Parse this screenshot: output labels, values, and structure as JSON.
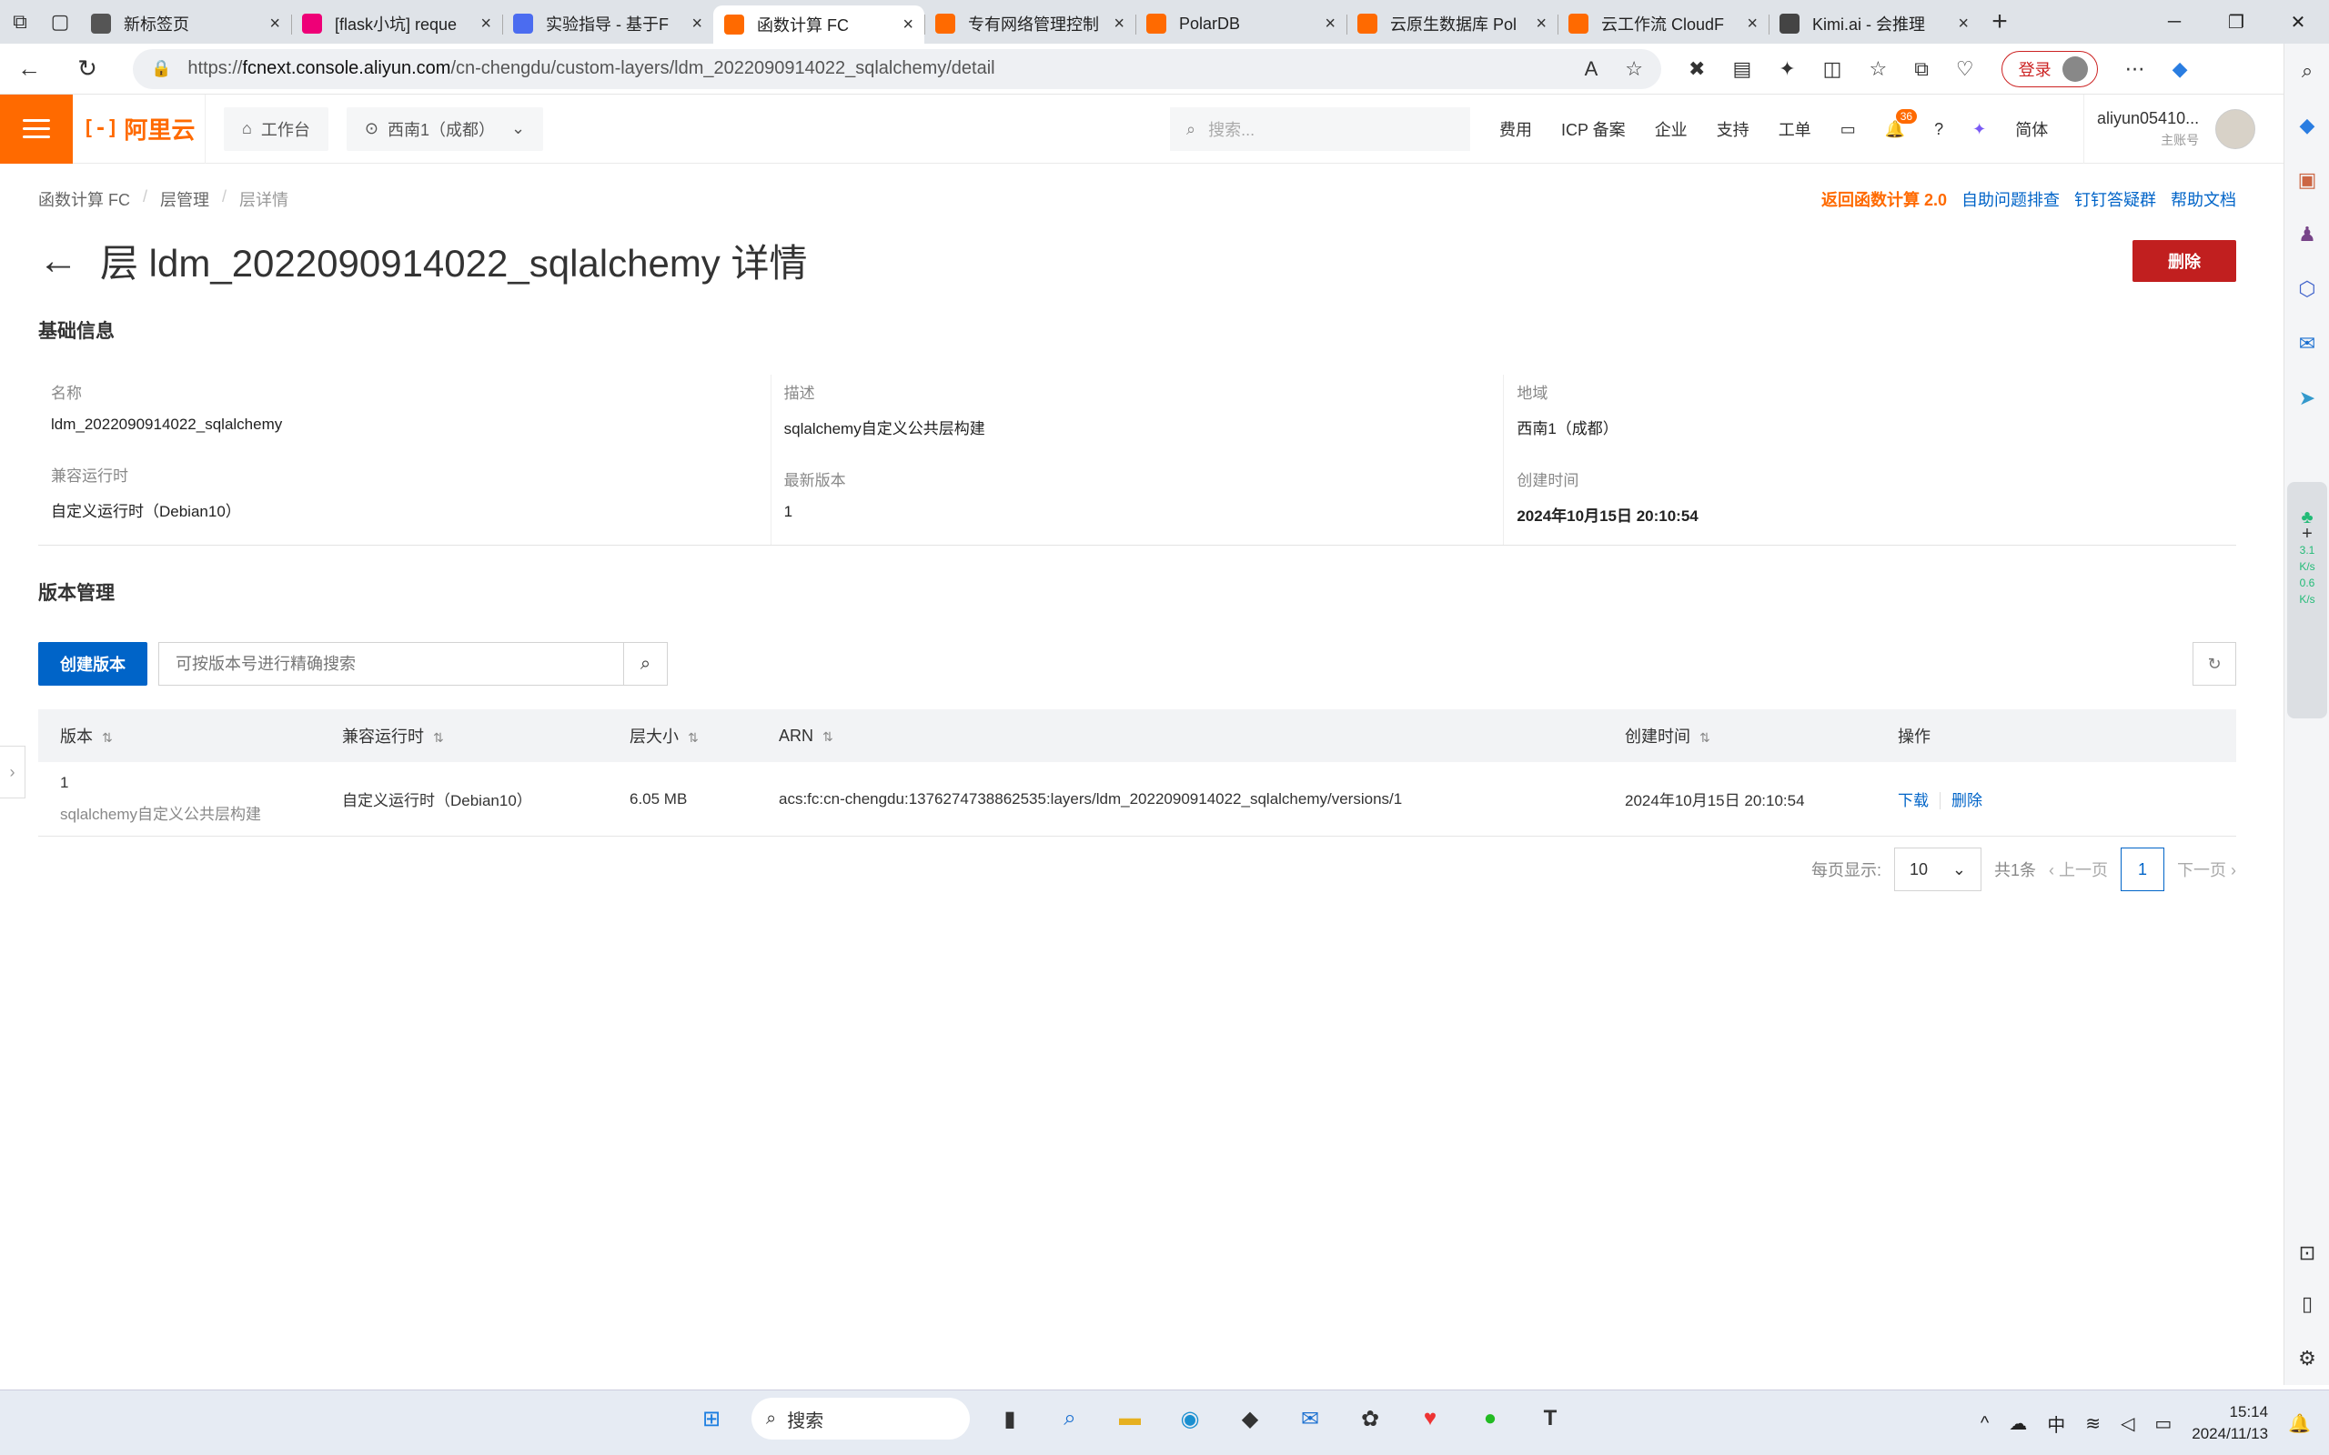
{
  "browser": {
    "tabs": [
      {
        "label": "新标签页",
        "icon_color": "#555",
        "active": false
      },
      {
        "label": "[flask小坑] reque",
        "icon_color": "#e07",
        "active": false
      },
      {
        "label": "实验指导 - 基于F",
        "icon_color": "#4b6cf0",
        "active": false
      },
      {
        "label": "函数计算 FC",
        "icon_color": "#ff6a00",
        "active": true
      },
      {
        "label": "专有网络管理控制",
        "icon_color": "#ff6a00",
        "active": false
      },
      {
        "label": "PolarDB",
        "icon_color": "#ff6a00",
        "active": false
      },
      {
        "label": "云原生数据库 Pol",
        "icon_color": "#ff6a00",
        "active": false
      },
      {
        "label": "云工作流 CloudF",
        "icon_color": "#ff6a00",
        "active": false
      },
      {
        "label": "Kimi.ai - 会推理",
        "icon_color": "#444",
        "active": false
      }
    ],
    "url_prefix": "https://",
    "url_domain": "fcnext.console.aliyun.com",
    "url_path": "/cn-chengdu/custom-layers/ldm_2022090914022_sqlalchemy/detail",
    "login_label": "登录"
  },
  "console_header": {
    "logo_text": "阿里云",
    "workbench_label": "工作台",
    "region_label": "西南1（成都）",
    "search_placeholder": "搜索...",
    "nav": [
      "费用",
      "ICP 备案",
      "企业",
      "支持",
      "工单"
    ],
    "notification_count": "36",
    "lang_label": "简体",
    "account_name": "aliyun05410...",
    "account_type": "主账号"
  },
  "breadcrumb": [
    "函数计算 FC",
    "层管理",
    "层详情"
  ],
  "top_links": {
    "back_fc2": "返回函数计算 2.0",
    "self_check": "自助问题排查",
    "dingtalk": "钉钉答疑群",
    "help": "帮助文档"
  },
  "page": {
    "title": "层 ldm_2022090914022_sqlalchemy 详情",
    "delete_label": "删除"
  },
  "basic_info": {
    "section_title": "基础信息",
    "name_label": "名称",
    "name_value": "ldm_2022090914022_sqlalchemy",
    "desc_label": "描述",
    "desc_value": "sqlalchemy自定义公共层构建",
    "region_label": "地域",
    "region_value": "西南1（成都）",
    "runtime_label": "兼容运行时",
    "runtime_value": "自定义运行时（Debian10）",
    "latest_label": "最新版本",
    "latest_value": "1",
    "created_label": "创建时间",
    "created_value": "2024年10月15日 20:10:54"
  },
  "versions": {
    "section_title": "版本管理",
    "create_label": "创建版本",
    "search_placeholder": "可按版本号进行精确搜索",
    "columns": [
      "版本",
      "兼容运行时",
      "层大小",
      "ARN",
      "创建时间",
      "操作"
    ],
    "rows": [
      {
        "version": "1",
        "description": "sqlalchemy自定义公共层构建",
        "runtime": "自定义运行时（Debian10）",
        "size": "6.05 MB",
        "arn": "acs:fc:cn-chengdu:1376274738862535:layers/ldm_2022090914022_sqlalchemy/versions/1",
        "created": "2024年10月15日 20:10:54",
        "action_download": "下载",
        "action_delete": "删除"
      }
    ]
  },
  "pagination": {
    "per_page_label": "每页显示:",
    "per_page_value": "10",
    "total_label": "共1条",
    "prev_label": "上一页",
    "current_page": "1",
    "next_label": "下一页"
  },
  "edge_monitor": {
    "up": "3.1",
    "up_unit": "K/s",
    "down": "0.6",
    "down_unit": "K/s"
  },
  "taskbar": {
    "search_label": "搜索",
    "ime_label": "中",
    "time": "15:14",
    "date": "2024/11/13"
  },
  "colors": {
    "brand": "#ff6a00",
    "primary": "#0064c8",
    "danger": "#c11f1f"
  }
}
